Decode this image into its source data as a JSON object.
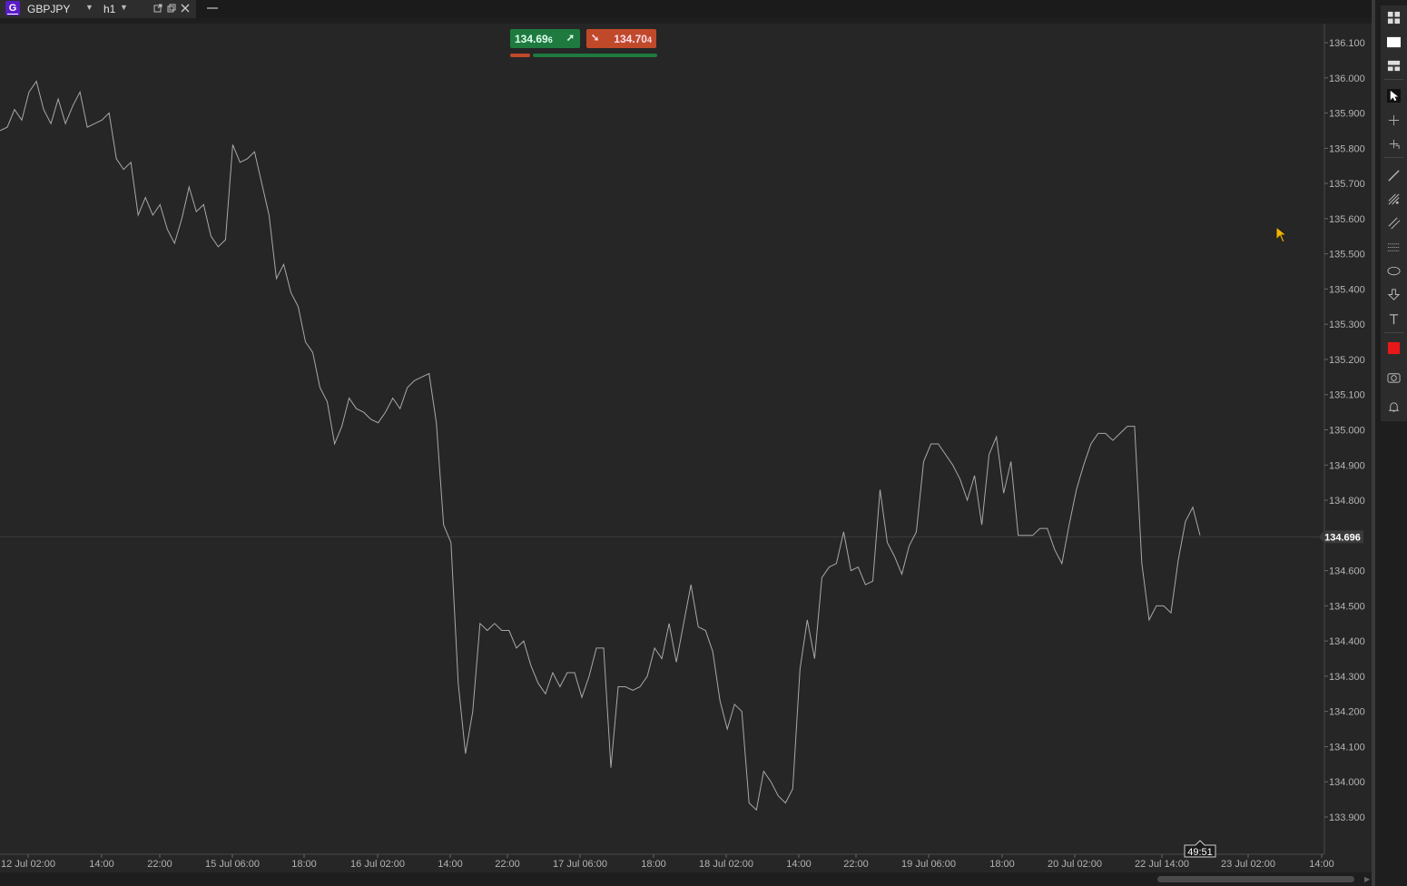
{
  "tab": {
    "badge": "G",
    "symbol": "GBPJPY",
    "timeframe": "h1"
  },
  "quote": {
    "bid": "134.69",
    "bid_pip": "6",
    "ask": "134.70",
    "ask_pip": "4",
    "current_price": "134.696",
    "candle_timer": "49:51"
  },
  "price_axis": [
    "136.100",
    "136.000",
    "135.900",
    "135.800",
    "135.700",
    "135.600",
    "135.500",
    "135.400",
    "135.300",
    "135.200",
    "135.100",
    "135.000",
    "134.900",
    "134.800",
    "134.600",
    "134.500",
    "134.400",
    "134.300",
    "134.200",
    "134.100",
    "134.000",
    "133.900"
  ],
  "time_axis": [
    "12 Jul 02:00",
    "14:00",
    "22:00",
    "15 Jul 06:00",
    "18:00",
    "16 Jul 02:00",
    "14:00",
    "22:00",
    "17 Jul 06:00",
    "18:00",
    "18 Jul 02:00",
    "14:00",
    "22:00",
    "19 Jul 06:00",
    "18:00",
    "20 Jul 02:00",
    "22 Jul 14:00",
    "23 Jul 02:00",
    "14:00"
  ],
  "colors": {
    "background": "#262626",
    "line": "#a8a8a8",
    "bid": "#1e7a3e",
    "ask": "#c0492a",
    "color_tool": "#e81818"
  },
  "toolbar": [
    "layout-grid-icon",
    "single-chart-icon",
    "split-chart-icon",
    "cursor-icon",
    "crosshair-icon",
    "measure-icon",
    "trendline-icon",
    "fibonacci-icon",
    "channel-icon",
    "levels-icon",
    "ellipse-icon",
    "arrow-down-icon",
    "text-icon",
    "color-swatch-icon",
    "screenshot-icon",
    "alert-bell-icon"
  ],
  "chart_data": {
    "type": "line",
    "ylim": [
      133.85,
      136.15
    ],
    "y": [
      135.85,
      135.86,
      135.91,
      135.88,
      135.96,
      135.99,
      135.91,
      135.87,
      135.94,
      135.87,
      135.92,
      135.96,
      135.86,
      135.87,
      135.88,
      135.9,
      135.77,
      135.74,
      135.76,
      135.61,
      135.66,
      135.61,
      135.64,
      135.57,
      135.53,
      135.6,
      135.69,
      135.62,
      135.64,
      135.55,
      135.52,
      135.54,
      135.81,
      135.76,
      135.77,
      135.79,
      135.7,
      135.61,
      135.43,
      135.47,
      135.39,
      135.35,
      135.25,
      135.22,
      135.12,
      135.08,
      134.96,
      135.01,
      135.09,
      135.06,
      135.05,
      135.03,
      135.02,
      135.05,
      135.09,
      135.06,
      135.12,
      135.14,
      135.15,
      135.16,
      135.02,
      134.73,
      134.68,
      134.28,
      134.08,
      134.2,
      134.45,
      134.43,
      134.45,
      134.43,
      134.43,
      134.38,
      134.4,
      134.33,
      134.28,
      134.25,
      134.31,
      134.27,
      134.31,
      134.31,
      134.24,
      134.3,
      134.38,
      134.38,
      134.04,
      134.27,
      134.27,
      134.26,
      134.27,
      134.3,
      134.38,
      134.35,
      134.45,
      134.34,
      134.45,
      134.56,
      134.44,
      134.43,
      134.37,
      134.23,
      134.15,
      134.22,
      134.2,
      133.94,
      133.92,
      134.03,
      134.0,
      133.96,
      133.94,
      133.98,
      134.32,
      134.46,
      134.35,
      134.58,
      134.61,
      134.62,
      134.71,
      134.6,
      134.61,
      134.56,
      134.57,
      134.83,
      134.68,
      134.64,
      134.59,
      134.67,
      134.71,
      134.91,
      134.96,
      134.96,
      134.93,
      134.9,
      134.86,
      134.8,
      134.87,
      134.73,
      134.93,
      134.98,
      134.82,
      134.91,
      134.7,
      134.7,
      134.7,
      134.72,
      134.72,
      134.66,
      134.62,
      134.73,
      134.83,
      134.9,
      134.96,
      134.99,
      134.99,
      134.97,
      134.99,
      135.01,
      135.01,
      134.62,
      134.46,
      134.5,
      134.5,
      134.48,
      134.63,
      134.74,
      134.78,
      134.7
    ]
  }
}
